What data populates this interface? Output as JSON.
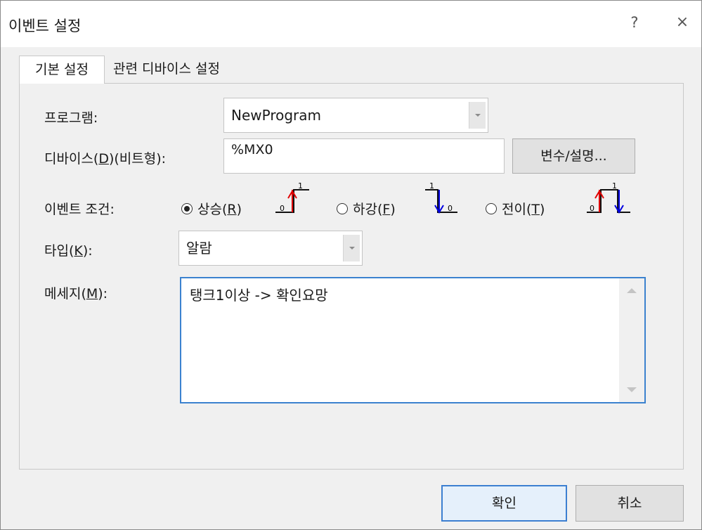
{
  "window": {
    "title": "이벤트 설정",
    "help": "?",
    "close": "×"
  },
  "tabs": [
    {
      "label": "기본 설정",
      "active": true
    },
    {
      "label": "관련 디바이스 설정",
      "active": false
    }
  ],
  "form": {
    "program": {
      "label": "프로그램:",
      "value": "NewProgram"
    },
    "device": {
      "label_pre": "디바이스(",
      "label_key": "D",
      "label_post": ")(비트형):",
      "value": "%MX0",
      "button": "변수/설명..."
    },
    "event_condition": {
      "label": "이벤트 조건:",
      "options": [
        {
          "pre": "상승(",
          "key": "R",
          "post": ")",
          "checked": true
        },
        {
          "pre": "하강(",
          "key": "F",
          "post": ")",
          "checked": false
        },
        {
          "pre": "전이(",
          "key": "T",
          "post": ")",
          "checked": false
        }
      ],
      "signal_high": "1",
      "signal_low": "0",
      "colors": {
        "rising": "#e00000",
        "falling": "#0000e0"
      }
    },
    "type": {
      "label_pre": "타입(",
      "label_key": "K",
      "label_post": "):",
      "value": "알람"
    },
    "message": {
      "label_pre": "메세지(",
      "label_key": "M",
      "label_post": "):",
      "value": "탱크1이상 -> 확인요망"
    }
  },
  "footer": {
    "ok": "확인",
    "cancel": "취소"
  },
  "colors": {
    "accent": "#3c7fd1",
    "background": "#f0f0f0"
  }
}
